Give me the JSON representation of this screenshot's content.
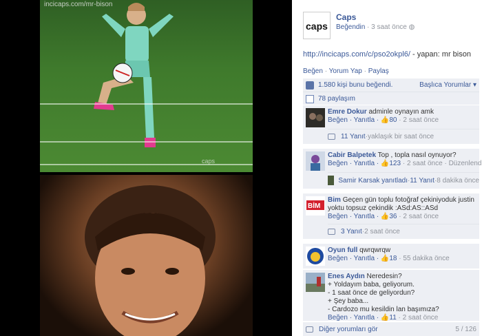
{
  "photo": {
    "watermark": "incicaps.com/mr-bison",
    "logo": "caps"
  },
  "post": {
    "page_name": "Caps",
    "page_avatar_text": "caps",
    "liked_label": "Beğendin",
    "time": "3 saat önce",
    "link_text": "http://incicaps.com/c/pso2okpl6/",
    "text_suffix": " - yapan: mr bison",
    "actions": {
      "like": "Beğen",
      "comment": "Yorum Yap",
      "share": "Paylaş"
    },
    "likes_text": "1.580 kişi bunu beğendi.",
    "sort_label": "Başlıca Yorumlar ▾",
    "shares_text": "78 paylaşım"
  },
  "comments": [
    {
      "author": "Emre Dokur",
      "text": "adminle oynayın amk",
      "like": "Beğen",
      "reply": "Yanıtla",
      "likes": "80",
      "time": "2 saat önce",
      "replies_label": "11 Yanıt",
      "replies_time": "yaklaşık bir saat önce"
    },
    {
      "author": "Cabir Balpetek",
      "text": "Top , topla nasıl oynuyor?",
      "like": "Beğen",
      "reply": "Yanıtla",
      "likes": "123",
      "time": "2 saat önce",
      "edited": "Düzenlendi",
      "replier": "Samir Karsak yanıtladı",
      "replies_label": "11 Yanıt",
      "replies_time": "8 dakika önce"
    },
    {
      "author": "Bim",
      "avatar_text": "BİM",
      "text": "Geçen gün toplu fotoğraf çekiniyoduk justin yoktu topsuz çekindik :ASd:AS::ASd",
      "like": "Beğen",
      "reply": "Yanıtla",
      "likes": "36",
      "time": "2 saat önce",
      "replies_label": "3 Yanıt",
      "replies_time": "2 saat önce"
    },
    {
      "author": "Oyun full",
      "text": "qwrqwrqw",
      "like": "Beğen",
      "reply": "Yanıtla",
      "likes": "18",
      "time": "55 dakika önce"
    },
    {
      "author": "Enes Aydın",
      "text": "Neredesin?",
      "lines": [
        "+ Yoldayım baba, geliyorum.",
        "- 1 saat önce de geliyordun?",
        "+ Şey baba...",
        "- Cardozo mu kesildin lan başımıza?"
      ],
      "like": "Beğen",
      "reply": "Yanıtla",
      "likes": "11",
      "time": "2 saat önce"
    }
  ],
  "footer": {
    "more_comments": "Diğer yorumları gör",
    "count": "5 / 126"
  },
  "colors": {
    "link": "#3b5998",
    "highlight": "#e2182a",
    "ufi_bg": "#edeff4"
  }
}
